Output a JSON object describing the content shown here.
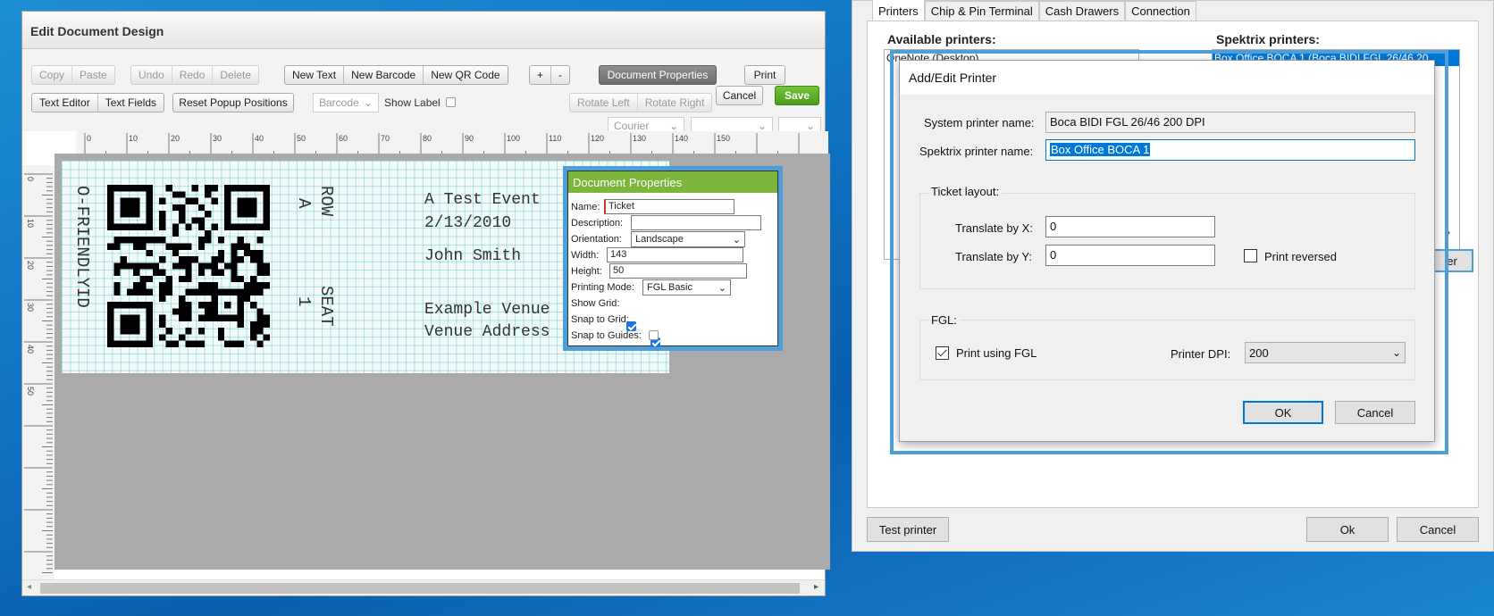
{
  "left_window": {
    "title": "Edit Document Design",
    "toolbar": {
      "copy": "Copy",
      "paste": "Paste",
      "undo": "Undo",
      "redo": "Redo",
      "delete": "Delete",
      "new_text": "New Text",
      "new_barcode": "New Barcode",
      "new_qr": "New QR Code",
      "plus": "+",
      "minus": "-",
      "document_properties": "Document Properties",
      "print": "Print",
      "text_editor": "Text Editor",
      "text_fields": "Text Fields",
      "reset_popup": "Reset Popup Positions",
      "barcode_select": "Barcode",
      "show_label": "Show Label",
      "rotate_left": "Rotate Left",
      "rotate_right": "Rotate Right",
      "cancel": "Cancel",
      "save": "Save",
      "font_select": "Courier"
    },
    "ruler": {
      "top": [
        "0",
        "10",
        "20",
        "30",
        "40",
        "50",
        "60",
        "70",
        "80",
        "90",
        "100",
        "110",
        "120",
        "130",
        "140",
        "150"
      ],
      "left": [
        "0",
        "10",
        "20",
        "30",
        "40",
        "50"
      ]
    },
    "ticket": {
      "friendly_id": "O-FRIENDLYID",
      "row_label": "ROW",
      "row_value": "A",
      "seat_label": "SEAT",
      "seat_value": "1",
      "event_name": "A Test Event",
      "event_date": "2/13/2010",
      "customer": "John Smith",
      "venue": "Example Venue",
      "venue_address": "Venue Address"
    },
    "doc_props": {
      "title": "Document Properties",
      "name_label": "Name:",
      "name_value": "Ticket",
      "description_label": "Description:",
      "description_value": "",
      "orientation_label": "Orientation:",
      "orientation_value": "Landscape",
      "width_label": "Width:",
      "width_value": "143",
      "height_label": "Height:",
      "height_value": "50",
      "printing_mode_label": "Printing Mode:",
      "printing_mode_value": "FGL Basic",
      "show_grid_label": "Show Grid:",
      "show_grid": true,
      "snap_grid_label": "Snap to Grid:",
      "snap_grid": true,
      "snap_guides_label": "Snap to Guides:",
      "snap_guides": false
    }
  },
  "right_window": {
    "tabs": [
      "Printers",
      "Chip & Pin Terminal",
      "Cash Drawers",
      "Connection"
    ],
    "available_label": "Available printers:",
    "available_first": "OneNote (Desktop)",
    "spektrix_label": "Spektrix printers:",
    "spektrix_first": "Box Office BOCA 1 (Boca BIDI FGL 26/46 20",
    "test_printer": "Test printer",
    "ok": "Ok",
    "cancel": "Cancel",
    "partial_button": "er"
  },
  "dialog": {
    "title": "Add/Edit Printer",
    "system_label": "System printer name:",
    "system_value": "Boca BIDI FGL 26/46 200 DPI",
    "spektrix_label": "Spektrix printer name:",
    "spektrix_value": "Box Office BOCA 1",
    "ticket_layout": "Ticket layout:",
    "translate_x_label": "Translate by X:",
    "translate_x": "0",
    "translate_y_label": "Translate by Y:",
    "translate_y": "0",
    "print_reversed": "Print reversed",
    "fgl_group": "FGL:",
    "print_fgl": "Print using FGL",
    "dpi_label": "Printer DPI:",
    "dpi_value": "200",
    "ok": "OK",
    "cancel": "Cancel"
  },
  "colors": {
    "accent_blue": "#4e9fd8",
    "save_green": "#5aa822",
    "doc_props_header": "#7bb63b",
    "selection_blue": "#0078d7"
  }
}
